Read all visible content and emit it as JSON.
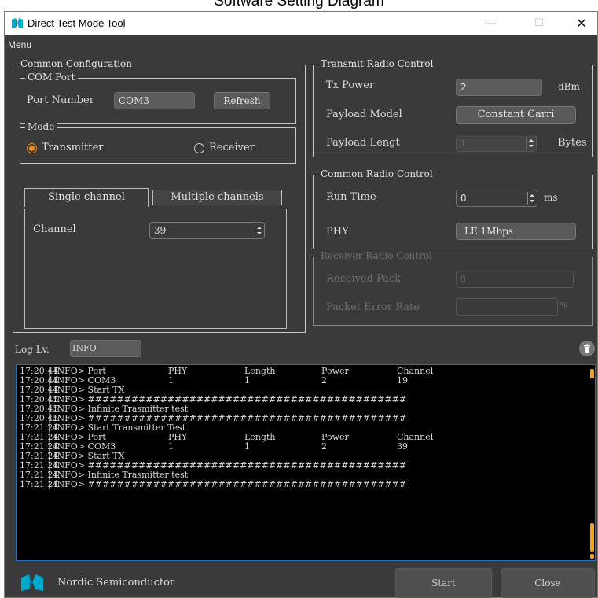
{
  "caption": "Software Setting Diagram",
  "window": {
    "title": "Direct Test Mode Tool",
    "minimize": "—",
    "maximize": "☐",
    "close": "✕"
  },
  "menu": {
    "label": "Menu"
  },
  "common_config": {
    "legend": "Common Configuration",
    "com_port": {
      "legend": "COM Port",
      "label": "Port Number",
      "value": "COM3",
      "refresh": "Refresh"
    },
    "mode": {
      "legend": "Mode",
      "transmitter": "Transmitter",
      "receiver": "Receiver",
      "selected": "Transmitter"
    },
    "tabs": {
      "single": "Single channel",
      "multiple": "Multiple channels"
    },
    "channel": {
      "label": "Channel",
      "value": "39"
    }
  },
  "transmit": {
    "legend": "Transmit Radio Control",
    "tx_power": {
      "label": "Tx Power",
      "value": "2",
      "unit": "dBm"
    },
    "payload_model": {
      "label": "Payload Model",
      "value": "Constant Carri"
    },
    "payload_length": {
      "label": "Payload Lengt",
      "value": "1",
      "unit": "Bytes"
    }
  },
  "common_radio": {
    "legend": "Common Radio Control",
    "run_time": {
      "label": "Run Time",
      "value": "0",
      "unit": "ms"
    },
    "phy": {
      "label": "PHY",
      "value": "LE 1Mbps"
    }
  },
  "receiver": {
    "legend": "Receiver Radio Control",
    "received": {
      "label": "Received Pack",
      "value": "0"
    },
    "per": {
      "label": "Packet Error Rate",
      "value": "",
      "unit": "%"
    }
  },
  "log": {
    "level_label": "Log Lv.",
    "level_value": "INFO",
    "clear_icon": "trash-icon",
    "lines": [
      [
        "17:20:44",
        "| INFO> Port",
        "PHY",
        "Length",
        "Power",
        "Channel"
      ],
      [
        "17:20:44",
        "| INFO> COM3",
        "1",
        "1",
        "2",
        "19"
      ],
      [
        "17:20:44",
        "| INFO> Start TX",
        "",
        "",
        "",
        ""
      ],
      [
        "17:20:45",
        "| INFO> ############################################",
        "",
        "",
        "",
        ""
      ],
      [
        "17:20:45",
        "| INFO> Infinite Trasmitter test",
        "",
        "",
        "",
        ""
      ],
      [
        "17:20:45",
        "| INFO> ############################################",
        "",
        "",
        "",
        ""
      ],
      [
        "17:21:24",
        "| INFO> Start Transmitter Test",
        "",
        "",
        "",
        ""
      ],
      [
        "17:21:24",
        "| INFO> Port",
        "PHY",
        "Length",
        "Power",
        "Channel"
      ],
      [
        "17:21:24",
        "| INFO> COM3",
        "1",
        "1",
        "2",
        "39"
      ],
      [
        "17:21:24",
        "| INFO> Start TX",
        "",
        "",
        "",
        ""
      ],
      [
        "17:21:24",
        "| INFO> ############################################",
        "",
        "",
        "",
        ""
      ],
      [
        "17:21:24",
        "| INFO> Infinite Trasmitter test",
        "",
        "",
        "",
        ""
      ],
      [
        "17:21:24",
        "| INFO> ############################################",
        "",
        "",
        "",
        ""
      ]
    ]
  },
  "footer": {
    "company": "Nordic Semiconductor",
    "start": "Start",
    "close": "Close"
  },
  "colors": {
    "accent": "#e88b19",
    "panel": "#3a3a3a",
    "log_border": "#2e6fb9"
  }
}
